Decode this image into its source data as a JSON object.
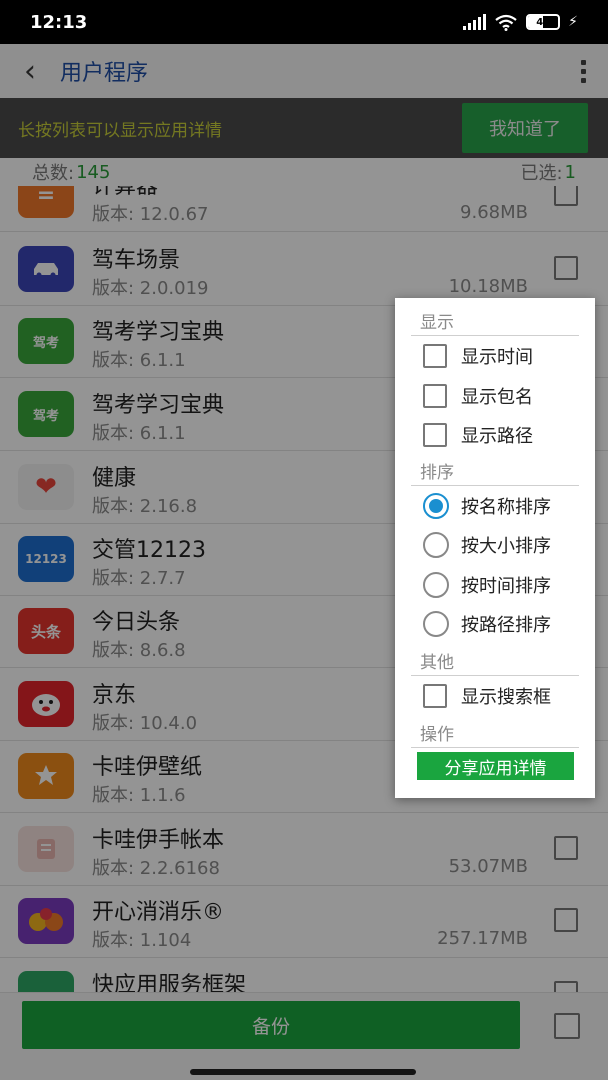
{
  "status_bar": {
    "time": "12:13",
    "battery": "49",
    "icons": [
      "signal-icon",
      "wifi-icon",
      "battery-icon",
      "charging-icon"
    ]
  },
  "header": {
    "title": "用户程序",
    "back_icon": "chevron-left-icon",
    "more_icon": "more-vertical-icon"
  },
  "tip": {
    "text": "长按列表可以显示应用详情",
    "button_label": "我知道了"
  },
  "counts": {
    "total_label": "总数:",
    "total_value": "145",
    "selected_label": "已选:",
    "selected_value": "1"
  },
  "apps": [
    {
      "name": "计算器",
      "version": "版本: 12.0.67",
      "size": "9.68MB",
      "icon_text": "="
    },
    {
      "name": "驾车场景",
      "version": "版本: 2.0.019",
      "size": "10.18MB",
      "icon_text": ""
    },
    {
      "name": "驾考学习宝典",
      "version": "版本: 6.1.1",
      "size": "",
      "icon_text": "驾考"
    },
    {
      "name": "驾考学习宝典",
      "version": "版本: 6.1.1",
      "size": "",
      "icon_text": "驾考"
    },
    {
      "name": "健康",
      "version": "版本: 2.16.8",
      "size": "",
      "icon_text": "❤"
    },
    {
      "name": "交管12123",
      "version": "版本: 2.7.7",
      "size": "",
      "icon_text": "12123"
    },
    {
      "name": "今日头条",
      "version": "版本: 8.6.8",
      "size": "",
      "icon_text": "头条"
    },
    {
      "name": "京东",
      "version": "版本: 10.4.0",
      "size": "",
      "icon_text": ""
    },
    {
      "name": "卡哇伊壁纸",
      "version": "版本: 1.1.6",
      "size": "",
      "icon_text": ""
    },
    {
      "name": "卡哇伊手帐本",
      "version": "版本: 2.2.6168",
      "size": "53.07MB",
      "icon_text": ""
    },
    {
      "name": "开心消消乐®",
      "version": "版本: 1.104",
      "size": "257.17MB",
      "icon_text": ""
    },
    {
      "name": "快应用服务框架",
      "version": "",
      "size": "",
      "icon_text": ""
    }
  ],
  "popup": {
    "display_header": "显示",
    "show_time": "显示时间",
    "show_package": "显示包名",
    "show_path": "显示路径",
    "sort_header": "排序",
    "sort_name": "按名称排序",
    "sort_size": "按大小排序",
    "sort_time": "按时间排序",
    "sort_path": "按路径排序",
    "other_header": "其他",
    "show_search": "显示搜索框",
    "action_header": "操作",
    "share_label": "分享应用详情",
    "selected_sort": "按名称排序"
  },
  "bottom": {
    "backup_label": "备份"
  },
  "colors": {
    "accent_green": "#1aa53f",
    "title_blue": "#1f4fa5",
    "radio_blue": "#1a8fd0",
    "tip_yellow": "#c9cf3a"
  }
}
